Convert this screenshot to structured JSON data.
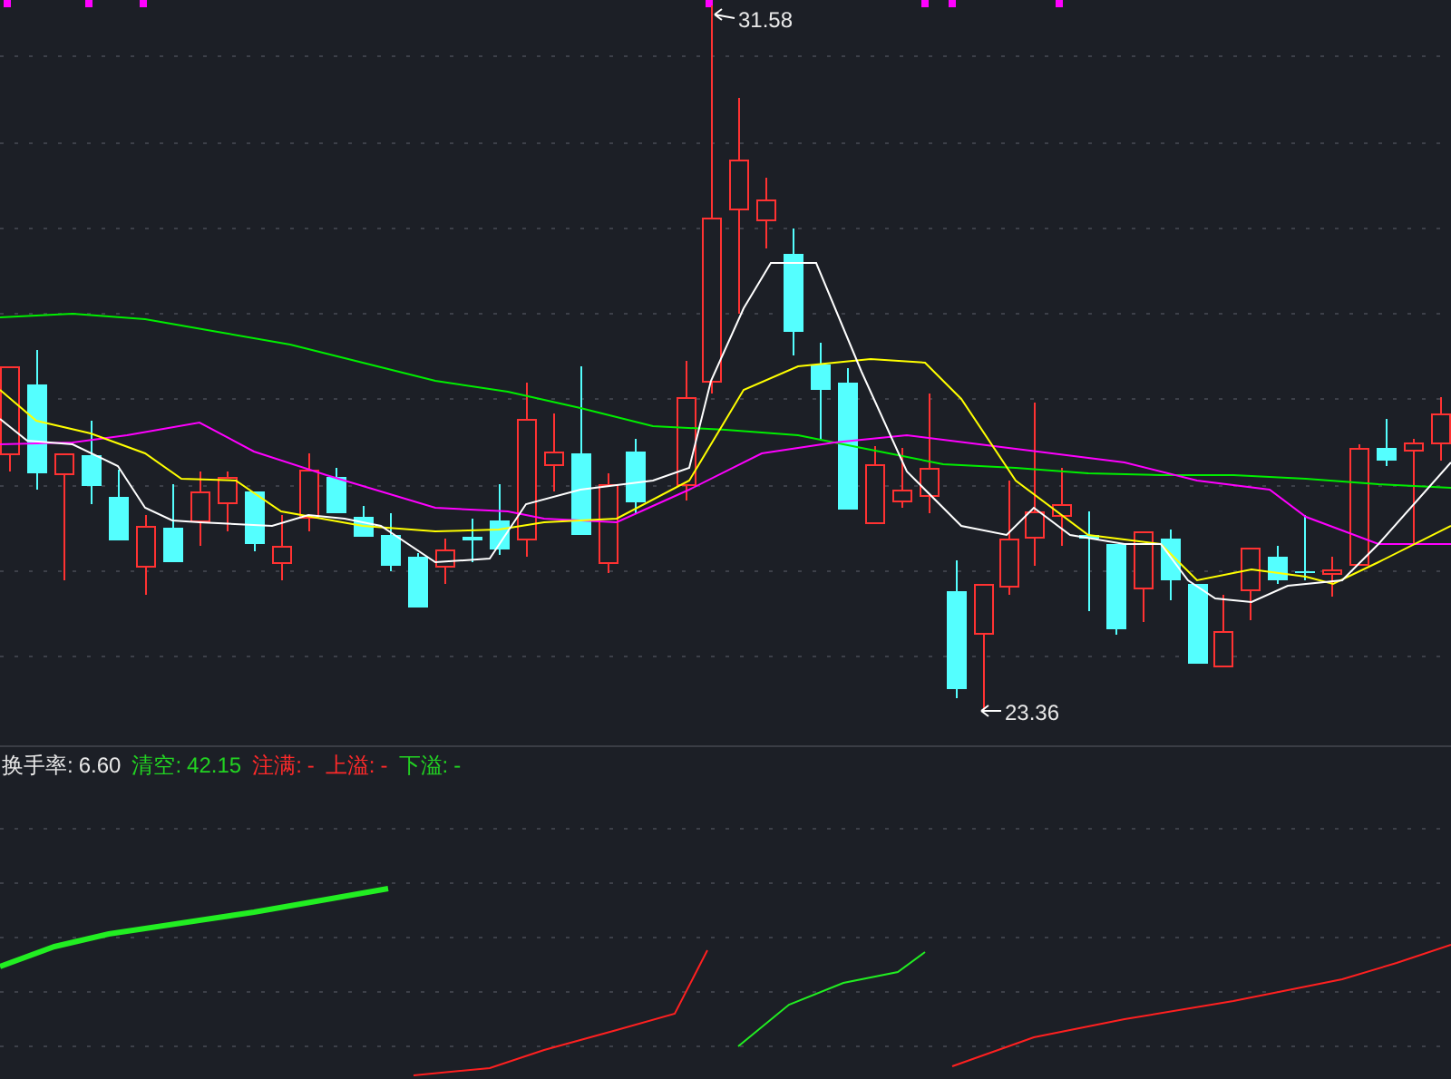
{
  "price_chart": {
    "high_marker": {
      "text": "31.58"
    },
    "low_marker": {
      "text": "23.36"
    }
  },
  "indicator_panel": {
    "legend": [
      {
        "label": "换手率:",
        "value": "6.60",
        "color": "#e8e8e8"
      },
      {
        "label": "清空:",
        "value": "42.15",
        "color": "#22d322"
      },
      {
        "label": "注满:",
        "value": "-",
        "color": "#ff2a2a"
      },
      {
        "label": "上溢:",
        "value": "-",
        "color": "#ff2a2a"
      },
      {
        "label": "下溢:",
        "value": "-",
        "color": "#22d322"
      }
    ]
  }
}
